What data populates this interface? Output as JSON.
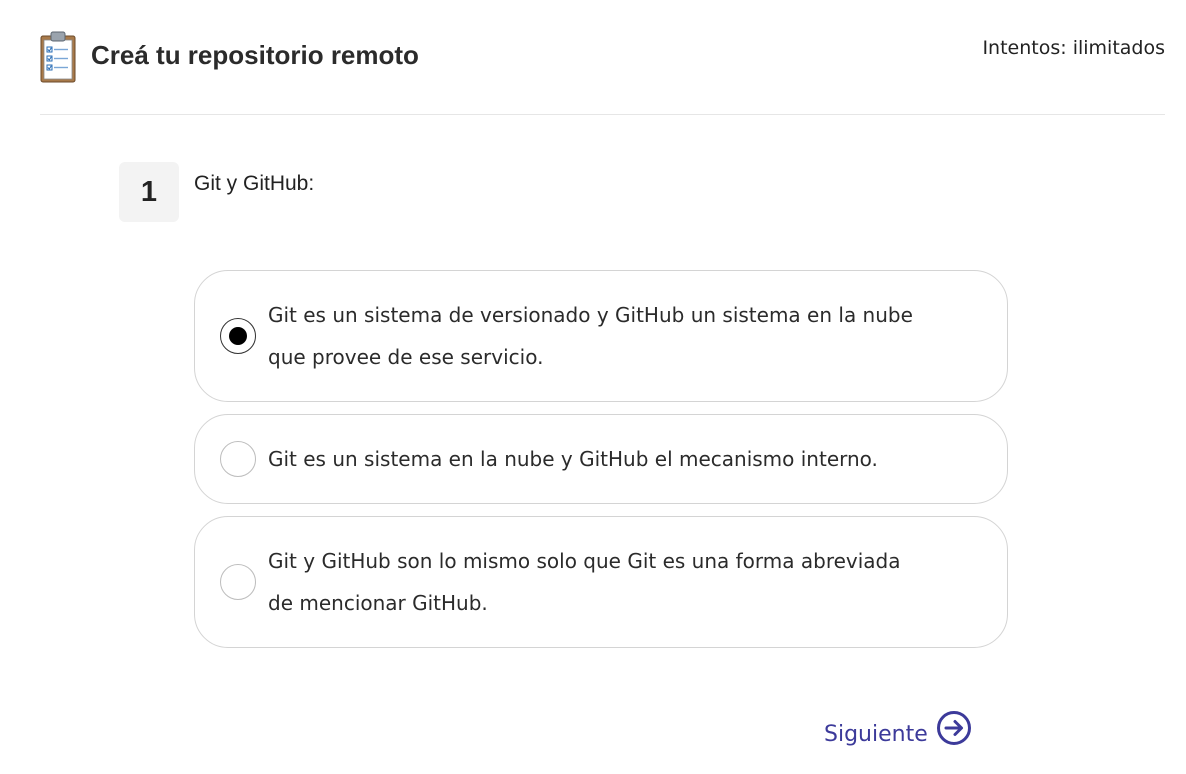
{
  "header": {
    "title": "Creá tu repositorio remoto",
    "attempts": "Intentos: ilimitados"
  },
  "question": {
    "number": "1",
    "text": "Git y GitHub:",
    "options": [
      {
        "label": "Git es un sistema de versionado y GitHub un sistema en la nube que provee de ese servicio.",
        "selected": true
      },
      {
        "label": "Git es un sistema en la nube y GitHub el mecanismo interno.",
        "selected": false
      },
      {
        "label": "Git y GitHub son lo mismo solo que Git es una forma abreviada de mencionar GitHub.",
        "selected": false
      }
    ]
  },
  "navigation": {
    "next_label": "Siguiente",
    "next_icon": "arrow-right-circle-icon",
    "accent_color": "#3c3a9a"
  },
  "icons": {
    "title_icon": "clipboard-checklist-icon"
  }
}
